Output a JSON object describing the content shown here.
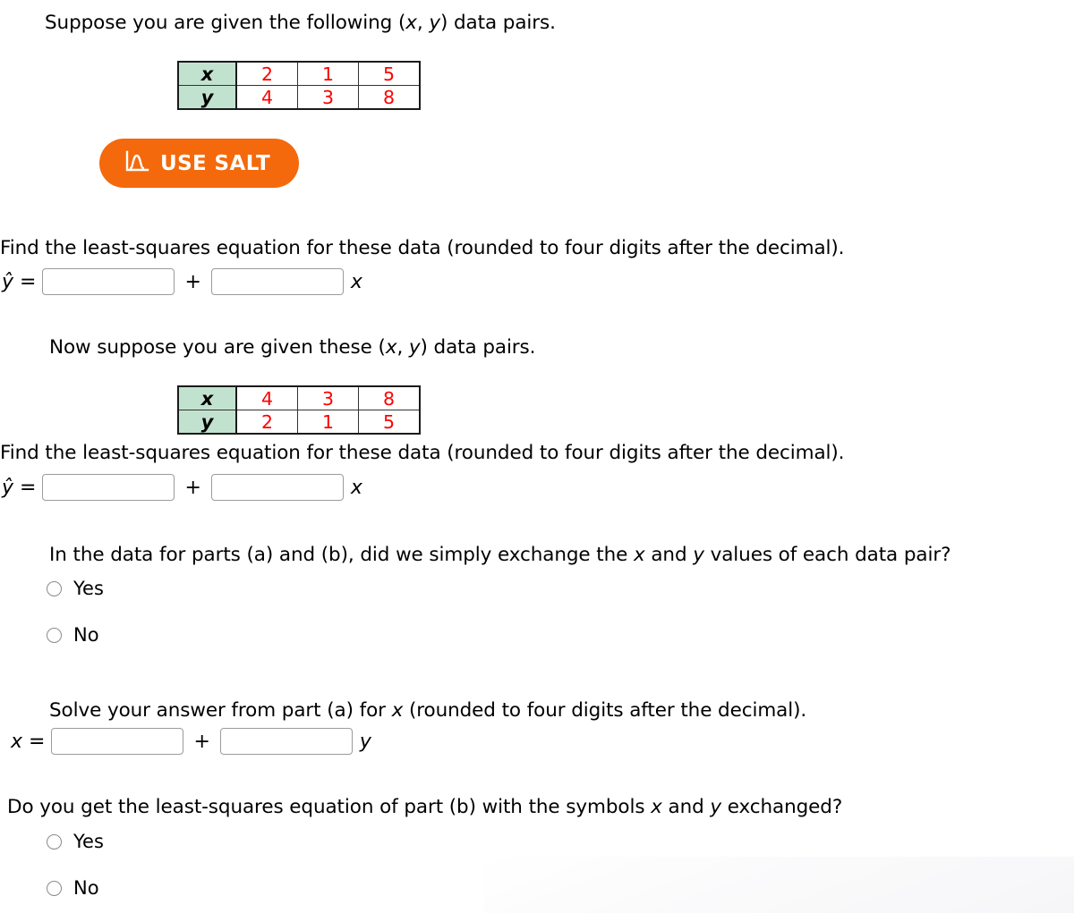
{
  "intro": {
    "line_a": "Suppose you are given the following (",
    "line_a_x": "x",
    "line_a_comma": ", ",
    "line_a_y": "y",
    "line_a_tail": ") data pairs."
  },
  "table_a": {
    "row_x_label": "x",
    "row_y_label": "y",
    "x_values": [
      "2",
      "1",
      "5"
    ],
    "y_values": [
      "4",
      "3",
      "8"
    ],
    "header_bg": "#c2e2d0",
    "value_color": "#ff0000"
  },
  "salt": {
    "label": "USE SALT",
    "icon": "distribution-curve-icon",
    "bg_color": "#f4690c",
    "text_color": "#ffffff"
  },
  "part_a": {
    "prompt": "Find the least-squares equation for these data (rounded to four digits after the decimal).",
    "lhs": "ŷ =",
    "intercept_value": "",
    "intercept_placeholder": "",
    "operator": "+",
    "slope_value": "",
    "slope_placeholder": "",
    "trailing_variable": "x"
  },
  "intro_b": {
    "text_before": "Now suppose you are given these (",
    "var_x": "x",
    "comma": ", ",
    "var_y": "y",
    "text_after": ") data pairs."
  },
  "table_b": {
    "row_x_label": "x",
    "row_y_label": "y",
    "x_values": [
      "4",
      "3",
      "8"
    ],
    "y_values": [
      "2",
      "1",
      "5"
    ],
    "header_bg": "#c2e2d0",
    "value_color": "#ff0000"
  },
  "part_b": {
    "prompt": "Find the least-squares equation for these data (rounded to four digits after the decimal).",
    "lhs": "ŷ =",
    "intercept_value": "",
    "intercept_placeholder": "",
    "operator": "+",
    "slope_value": "",
    "slope_placeholder": "",
    "trailing_variable": "x"
  },
  "part_c": {
    "question_1": "In the data for parts (a) and (b), did we simply exchange the ",
    "question_var_x": "x",
    "question_2": " and ",
    "question_var_y": "y",
    "question_3": " values of each data pair?",
    "options": [
      {
        "label": "Yes",
        "selected": false
      },
      {
        "label": "No",
        "selected": false
      }
    ]
  },
  "part_d": {
    "prompt_before": "Solve your answer from part (a) for ",
    "prompt_var": "x",
    "prompt_after": " (rounded to four digits after the decimal).",
    "lhs": "x =",
    "intercept_value": "",
    "intercept_placeholder": "",
    "operator": "+",
    "slope_value": "",
    "slope_placeholder": "",
    "trailing_variable": "y"
  },
  "part_e": {
    "question_1": "Do you get the least-squares equation of part (b) with the symbols ",
    "question_var_x": "x",
    "question_2": " and ",
    "question_var_y": "y",
    "question_3": " exchanged?",
    "options": [
      {
        "label": "Yes",
        "selected": false
      },
      {
        "label": "No",
        "selected": false
      }
    ]
  }
}
